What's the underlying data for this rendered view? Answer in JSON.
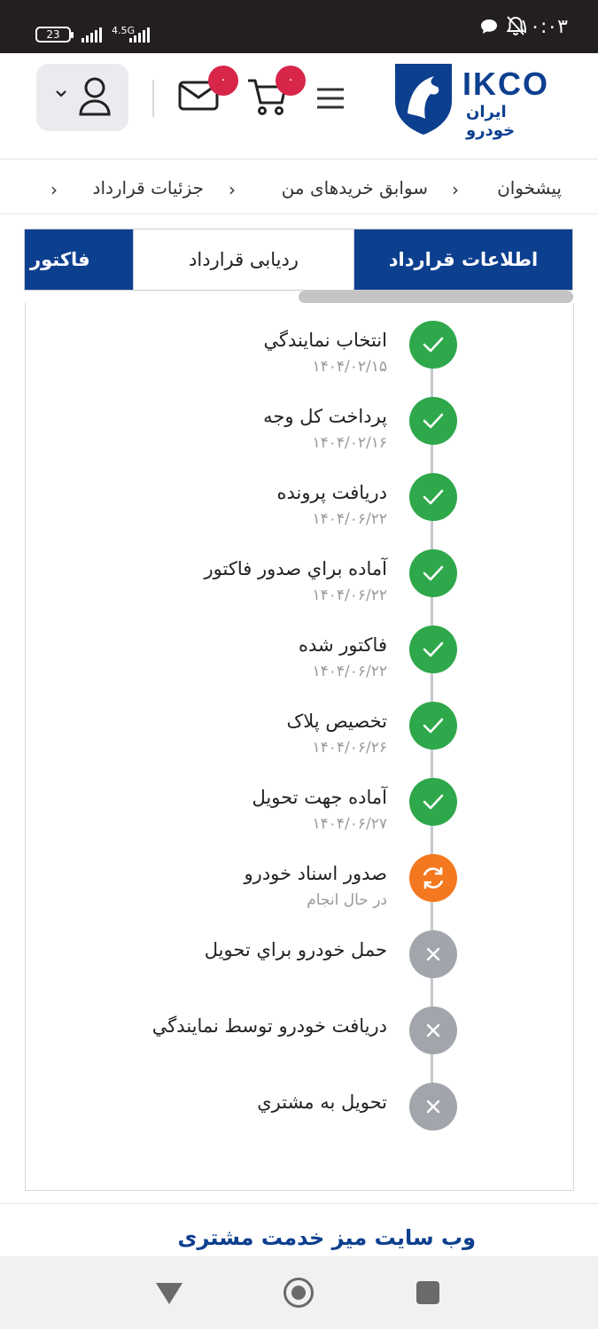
{
  "status_bar": {
    "time": "۱۰:۰۳",
    "battery": "23",
    "network": "4.5G"
  },
  "header": {
    "logo_text": "IKCO",
    "logo_sub": "ایران خودرو",
    "mail_badge": "۰",
    "cart_badge": "۰",
    "accent_color": "#0d3f8f",
    "badge_color": "#d7264a"
  },
  "breadcrumb": {
    "items": [
      "پیشخوان",
      "سوابق خریدهای من",
      "جزئیات قرارداد"
    ]
  },
  "tabs": {
    "info": "اطلاعات قرارداد",
    "tracking": "ردیابی قرارداد",
    "invoice": "فاکتور"
  },
  "timeline": {
    "steps": [
      {
        "title": "انتخاب نمايندگي",
        "date": "۱۴۰۴/۰۲/۱۵",
        "status": "done"
      },
      {
        "title": "پرداخت کل وجه",
        "date": "۱۴۰۴/۰۲/۱۶",
        "status": "done"
      },
      {
        "title": "دريافت پرونده",
        "date": "۱۴۰۴/۰۶/۲۲",
        "status": "done"
      },
      {
        "title": "آماده براي صدور فاکتور",
        "date": "۱۴۰۴/۰۶/۲۲",
        "status": "done"
      },
      {
        "title": "فاکتور شده",
        "date": "۱۴۰۴/۰۶/۲۲",
        "status": "done"
      },
      {
        "title": "تخصيص پلاک",
        "date": "۱۴۰۴/۰۶/۲۶",
        "status": "done"
      },
      {
        "title": "آماده جهت تحويل",
        "date": "۱۴۰۴/۰۶/۲۷",
        "status": "done"
      },
      {
        "title": "صدور اسناد خودرو",
        "date": "در حال انجام",
        "status": "in-progress"
      },
      {
        "title": "حمل خودرو براي تحويل",
        "date": "",
        "status": "pending"
      },
      {
        "title": "دريافت خودرو توسط نمايندگي",
        "date": "",
        "status": "pending"
      },
      {
        "title": "تحويل به مشتري",
        "date": "",
        "status": "pending"
      }
    ],
    "colors": {
      "done": "#2ea84a",
      "in-progress": "#f47820",
      "pending": "#a2a5ab"
    }
  },
  "footer": {
    "title": "وب سایت میز خدمت مشتری"
  }
}
